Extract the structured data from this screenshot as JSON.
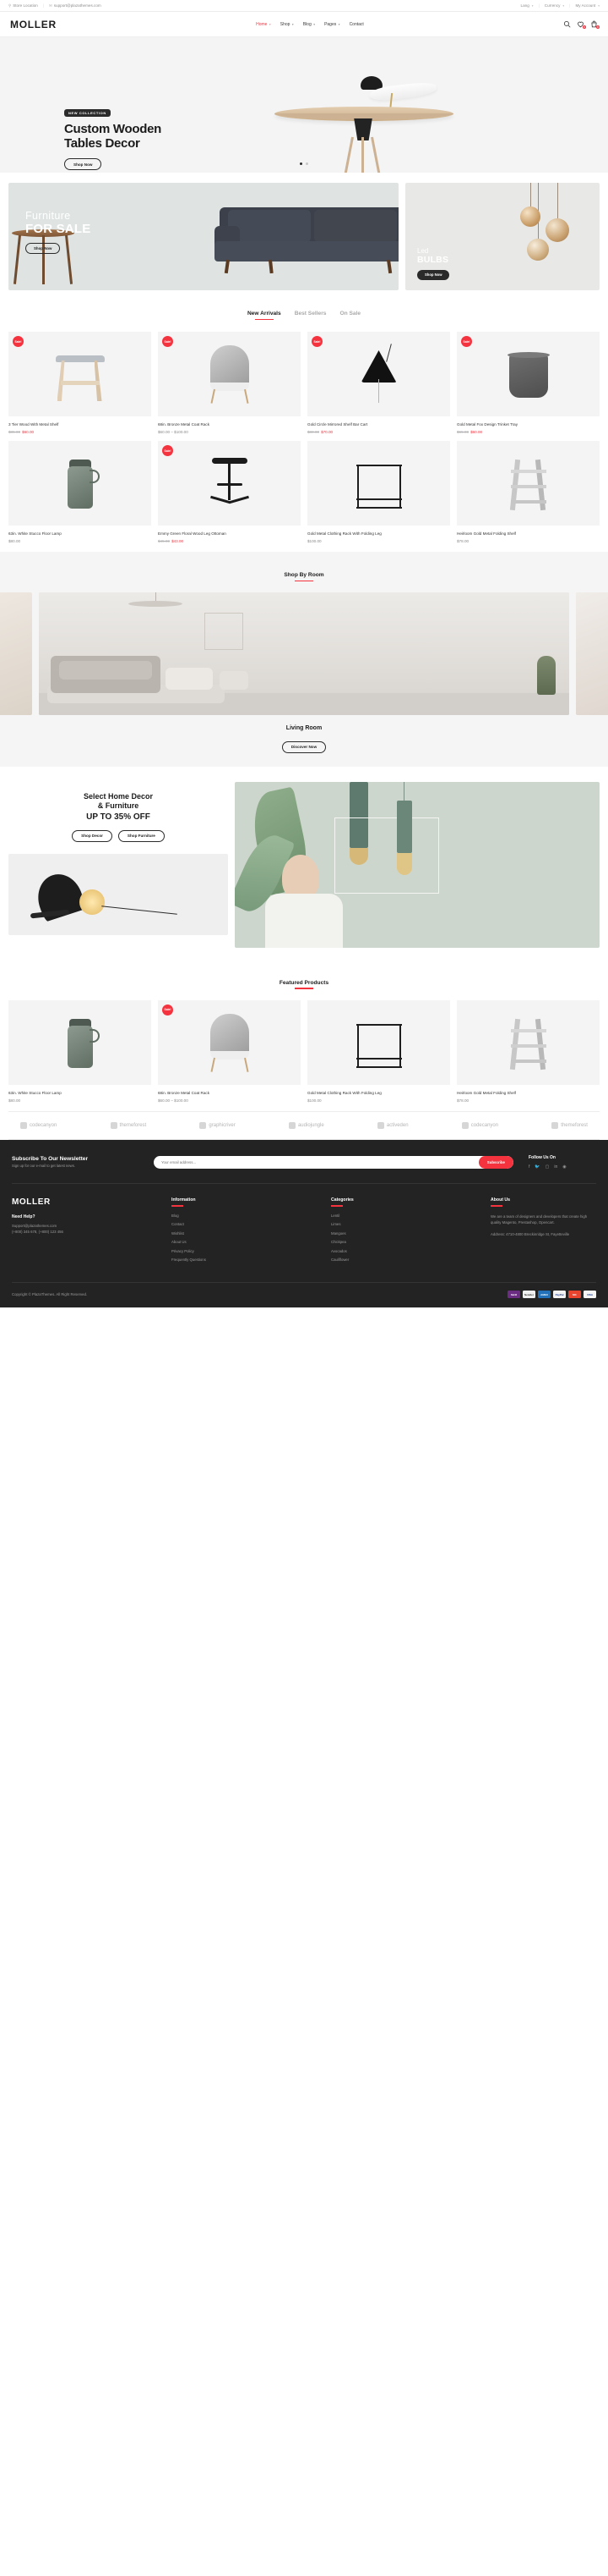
{
  "topbar": {
    "store_location": "Store Location",
    "email": "support@plazathemes.com",
    "lang": "Lang",
    "currency": "Currency",
    "account": "My Account",
    "location_icon": "map-pin-icon",
    "email_icon": "envelope-icon"
  },
  "header": {
    "logo": "MOLLER",
    "nav": [
      {
        "label": "Home",
        "caret": true,
        "active": true
      },
      {
        "label": "Shop",
        "caret": true,
        "active": false
      },
      {
        "label": "Blog",
        "caret": true,
        "active": false
      },
      {
        "label": "Pages",
        "caret": true,
        "active": false
      },
      {
        "label": "Contact",
        "caret": false,
        "active": false
      }
    ],
    "icons": {
      "search": "search-icon",
      "wishlist": "heart-icon",
      "cart": "bag-icon",
      "wishlist_count": "0",
      "cart_count": "0"
    }
  },
  "hero": {
    "tag": "NEW COLLECTION",
    "title_line1": "Custom Wooden",
    "title_line2": "Tables Decor",
    "cta": "Shop Now",
    "dots": 2,
    "active_dot": 0
  },
  "promos": {
    "left": {
      "line1": "Furniture",
      "line2": "FOR SALE",
      "cta": "Shop Now",
      "bg": "#dfe4e3"
    },
    "right": {
      "line1": "Led",
      "line2": "BULBS",
      "cta": "Shop Now",
      "bg": "#e8e8e6"
    }
  },
  "arrivals": {
    "tabs": [
      {
        "label": "New Arrivals",
        "active": true
      },
      {
        "label": "Best Sellers",
        "active": false
      },
      {
        "label": "On Sale",
        "active": false
      }
    ],
    "products": [
      {
        "name": "3 Tier Wood With Metal Shelf",
        "old": "$85.00",
        "new": "$60.00",
        "sale": true,
        "art": "stool"
      },
      {
        "name": "68in. Bronze Metal Coat Rack",
        "old": "",
        "new": "",
        "range": "$60.00 – $100.00",
        "sale": true,
        "art": "chair"
      },
      {
        "name": "Gold Circle Mirrored Shelf Bar Cart",
        "old": "$80.00",
        "new": "$70.00",
        "sale": true,
        "art": "blamp"
      },
      {
        "name": "Gold Metal Fox Design Trinket Tray",
        "old": "$65.00",
        "new": "$60.00",
        "sale": true,
        "art": "vessel"
      },
      {
        "name": "63in. White Stucco Floor Lamp",
        "old": "",
        "new": "",
        "range": "$80.00",
        "sale": false,
        "art": "thermos"
      },
      {
        "name": "Emmy Green Floral Wood Leg Ottoman",
        "old": "$45.00",
        "new": "$43.00",
        "sale": true,
        "art": "ottoman"
      },
      {
        "name": "Gold Metal Clothing Rack With Folding Leg",
        "old": "",
        "new": "",
        "range": "$100.00",
        "sale": false,
        "art": "rack"
      },
      {
        "name": "Heirloom Gold Metal Folding Shelf",
        "old": "",
        "new": "",
        "range": "$78.00",
        "sale": false,
        "art": "fshelf"
      }
    ]
  },
  "room": {
    "title": "Shop By Room",
    "label": "Living Room",
    "cta": "Discover Now"
  },
  "decor": {
    "line1": "Select Home Decor",
    "line2": "& Furniture",
    "line3": "UP TO 35% OFF",
    "cta1": "Shop Decor",
    "cta2": "Shop Furniture"
  },
  "featured": {
    "title": "Featured Products",
    "products": [
      {
        "name": "63in. White Stucco Floor Lamp",
        "range": "$80.00",
        "sale": false,
        "art": "thermos"
      },
      {
        "name": "68in. Bronze Metal Coat Rack",
        "range": "$60.00 – $100.00",
        "sale": true,
        "art": "chair"
      },
      {
        "name": "Gold Metal Clothing Rack With Folding Leg",
        "range": "$100.00",
        "sale": false,
        "art": "rack"
      },
      {
        "name": "Heirloom Gold Metal Folding Shelf",
        "range": "$78.00",
        "sale": false,
        "art": "fshelf"
      }
    ]
  },
  "brands": [
    {
      "name": "codecanyon"
    },
    {
      "name": "themeforest"
    },
    {
      "name": "graphicriver"
    },
    {
      "name": "audiojungle"
    },
    {
      "name": "activeden"
    },
    {
      "name": "codecanyon"
    },
    {
      "name": "themeforest"
    }
  ],
  "newsletter": {
    "title": "Subscribe To Our Newsletter",
    "subtitle": "Sign up for our e-mail to get latest news.",
    "placeholder": "Your email address...",
    "value": "",
    "button": "Subscribe",
    "follow_title": "Follow Us On",
    "socials": [
      "facebook-icon",
      "twitter-icon",
      "instagram-icon",
      "linkedin-icon",
      "rss-icon"
    ],
    "accent": "#f5333f"
  },
  "footer": {
    "logo": "MOLLER",
    "need_help": "Need Help?",
    "email": "Support@plazathemes.com",
    "phone": "(+800) 345 678, (+800) 123 456",
    "information": {
      "title": "Information",
      "items": [
        "Blog",
        "Contact",
        "Wishlist",
        "About Us",
        "Privacy Policy",
        "Frequently Questions"
      ]
    },
    "categories": {
      "title": "Categories",
      "items": [
        "Lentil",
        "Limes",
        "Mangoes",
        "Chickpea",
        "Avocados",
        "Cauliflower"
      ]
    },
    "about": {
      "title": "About Us",
      "text": "We are a team of designers and developers that create high quality Magento, Prestashop, Opencart.",
      "address": "Address: 4710-4800 Breckinridge St, Fayetteville"
    },
    "copyright": "Copyright © PlazaThemes. All Right Reserved.",
    "payments": [
      {
        "label": "Skrill",
        "bg": "#6a2d82"
      },
      {
        "label": "Neteller",
        "bg": "#efefef",
        "fg": "#3a3a3a"
      },
      {
        "label": "AMEX",
        "bg": "#2170b8"
      },
      {
        "label": "PayPal",
        "bg": "#f2f2f2",
        "fg": "#1d3c8f"
      },
      {
        "label": "MC",
        "bg": "#e8442e"
      },
      {
        "label": "VISA",
        "bg": "#f5f5f5",
        "fg": "#1a3a8f"
      }
    ]
  }
}
